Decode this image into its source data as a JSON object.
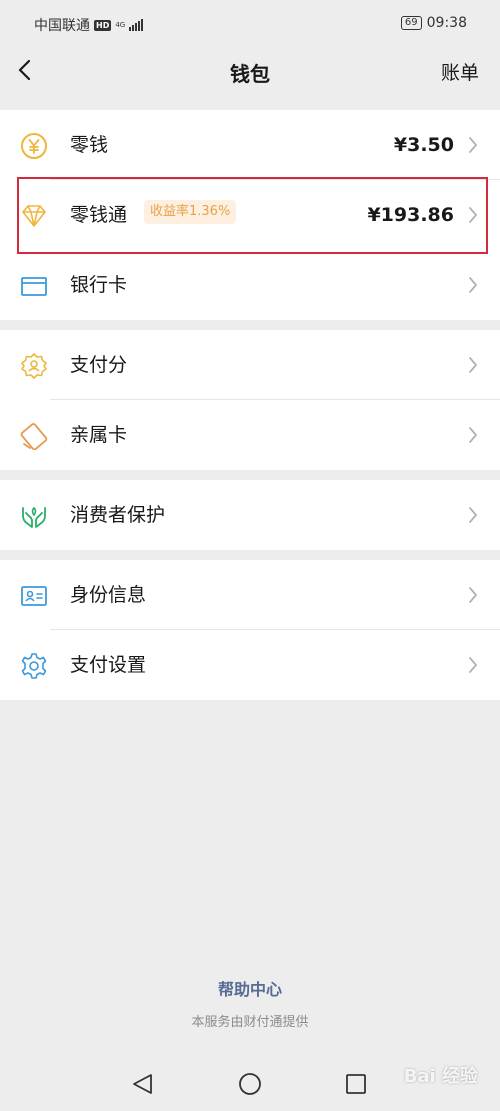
{
  "status_bar": {
    "carrier": "中国联通",
    "hd": "HD",
    "network": "4G",
    "battery": "69",
    "time": "09:38"
  },
  "nav": {
    "title": "钱包",
    "right_label": "账单"
  },
  "groups": {
    "wallet": [
      {
        "label": "零钱",
        "value": "¥3.50",
        "icon": "yuan-coin-icon"
      },
      {
        "label": "零钱通",
        "value": "¥193.86",
        "badge": "收益率1.36%",
        "icon": "diamond-icon"
      },
      {
        "label": "银行卡",
        "icon": "bank-card-icon"
      }
    ],
    "credit": [
      {
        "label": "支付分",
        "icon": "payscore-badge-icon"
      },
      {
        "label": "亲属卡",
        "icon": "family-card-icon"
      }
    ],
    "protection": [
      {
        "label": "消费者保护",
        "icon": "protect-hands-icon"
      }
    ],
    "settings": [
      {
        "label": "身份信息",
        "icon": "id-card-icon"
      },
      {
        "label": "支付设置",
        "icon": "gear-icon"
      }
    ]
  },
  "footer": {
    "help": "帮助中心",
    "provider": "本服务由财付通提供"
  },
  "watermark": "Bai 经验",
  "colors": {
    "background": "#ededed",
    "highlight_border": "#d22c3c",
    "badge_text": "#e8a14a",
    "link": "#576b95"
  }
}
